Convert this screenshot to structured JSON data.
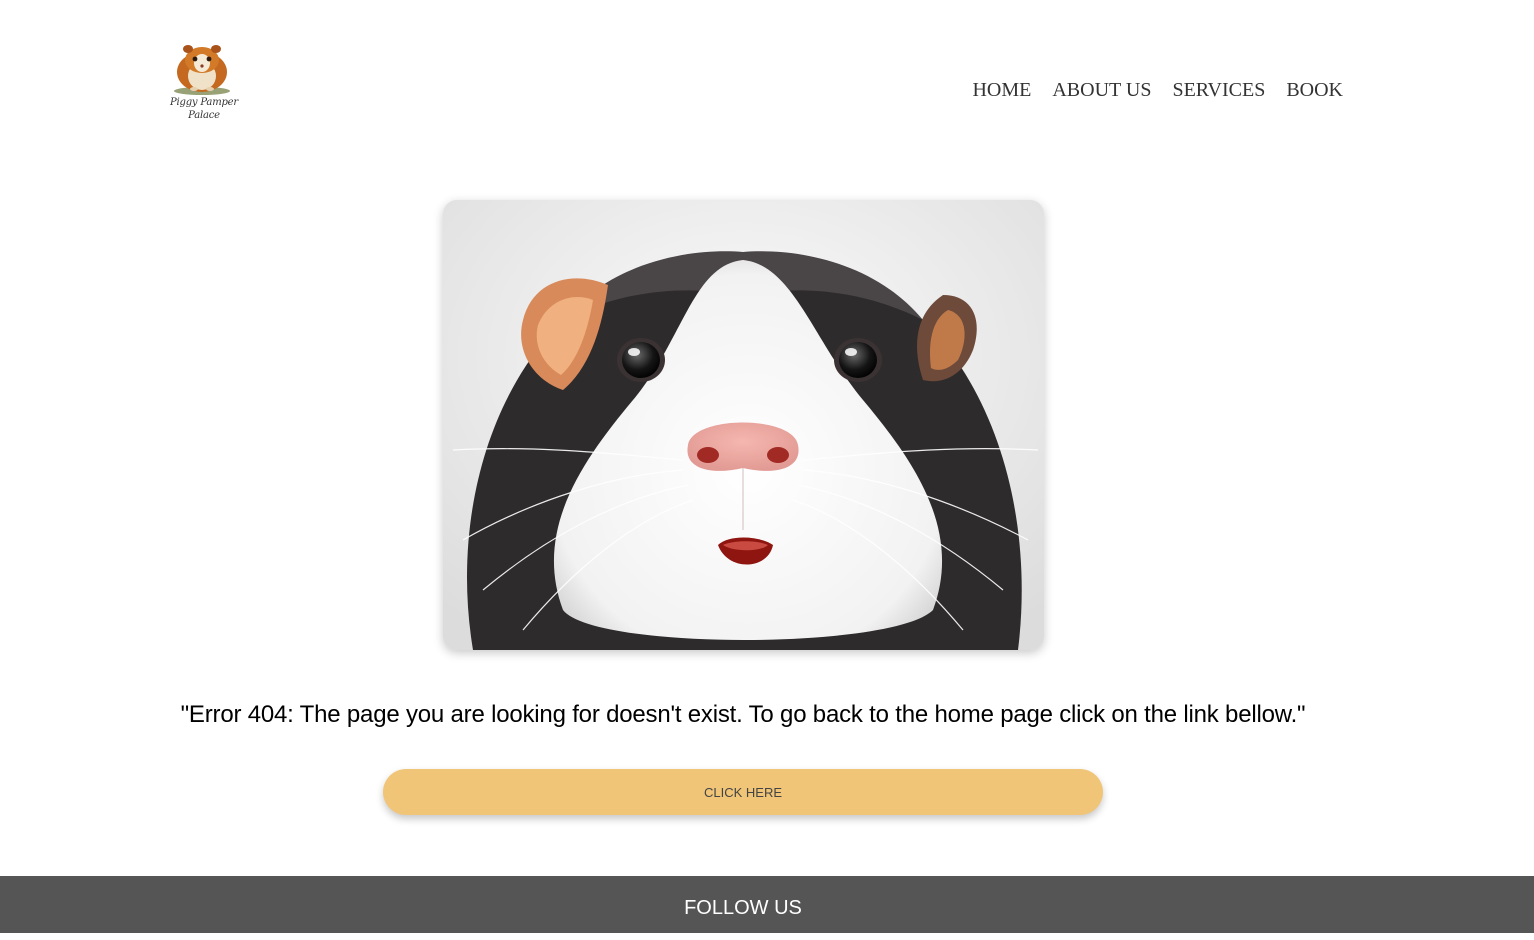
{
  "header": {
    "logo_text": "Piggy Pamper Palace",
    "nav": {
      "home": "HOME",
      "about": "ABOUT US",
      "services": "SERVICES",
      "book": "BOOK"
    }
  },
  "main": {
    "message": "\"Error 404: The page you are looking for doesn't exist. To go back to the home page click on the link bellow.\"",
    "button_label": "CLICK HERE"
  },
  "footer": {
    "title": "FOLLOW US"
  },
  "colors": {
    "button": "#f0c578",
    "footer": "#555555",
    "nav_text": "#333333"
  },
  "icons": {
    "logo": "guinea-pig-logo-icon",
    "hero": "guinea-pig-image"
  }
}
